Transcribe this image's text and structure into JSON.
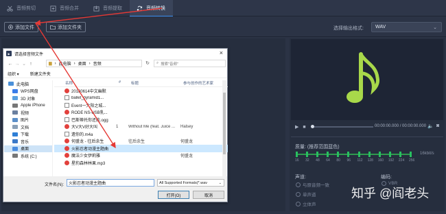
{
  "tabs": [
    {
      "label": "音频剪切",
      "icon": "scissors-icon"
    },
    {
      "label": "音频合并",
      "icon": "merge-icon"
    },
    {
      "label": "音频提取",
      "icon": "extract-icon"
    },
    {
      "label": "音频转换",
      "icon": "convert-icon",
      "active": true
    }
  ],
  "toolbar": {
    "add_file": "添加文件",
    "add_folder": "添加文件夹",
    "output_format_label": "选择输出格式:",
    "output_format_value": "WAV"
  },
  "dialog": {
    "title": "请选择音频文件",
    "close": "×",
    "breadcrumb": [
      "此电脑",
      "桌面",
      "音频"
    ],
    "search_placeholder": "搜索\"音频\"",
    "organize": "组织 ▾",
    "new_folder": "新建文件夹",
    "columns": [
      "名称",
      "#",
      "标题",
      "参与创作的艺术家"
    ],
    "nav_items": [
      "此电脑",
      "WPS网盘",
      "3D 对象",
      "Apple iPhone",
      "视频",
      "图片",
      "文档",
      "下载",
      "音乐",
      "桌面",
      "系统 (C:)"
    ],
    "files": [
      {
        "name": "20180614中文幽默",
        "num": "",
        "title": "",
        "artist": "",
        "icon": "red"
      },
      {
        "name": "ballet_pyramid1...",
        "num": "",
        "title": "",
        "artist": "",
        "icon": "doc"
      },
      {
        "name": "Event一大阳之城...",
        "num": "",
        "title": "",
        "artist": "",
        "icon": "doc"
      },
      {
        "name": "RODE NS-USB乳...",
        "num": "",
        "title": "",
        "artist": "",
        "icon": "red"
      },
      {
        "name": "巴斯蒂托你还能.ogg",
        "num": "",
        "title": "",
        "artist": "",
        "icon": "doc"
      },
      {
        "name": "大V大V好大叫",
        "num": "1",
        "title": "Without Me (feat. Juice ...",
        "artist": "Halsey",
        "icon": "red"
      },
      {
        "name": "遗你的.m4a",
        "num": "",
        "title": "",
        "artist": "",
        "icon": "doc"
      },
      {
        "name": "何盛龙 - 往后余生",
        "num": "",
        "title": "往后余生",
        "artist": "何盛龙",
        "icon": "red"
      },
      {
        "name": "火影忍者动漫主题曲",
        "num": "",
        "title": "",
        "artist": "",
        "icon": "red",
        "selected": true
      },
      {
        "name": "魔法少女伊莉雅",
        "num": "",
        "title": "",
        "artist": "何盛龙",
        "icon": "red"
      },
      {
        "name": "星豹森林林果.mp3",
        "num": "",
        "title": "",
        "artist": "",
        "icon": "red"
      }
    ],
    "filename_label": "文件名(N):",
    "filename_value": "火影忍者动漫主题曲",
    "filetype_value": "All Supported Formats(*.wav",
    "open_button": "打开(O)",
    "cancel_button": "取消"
  },
  "player": {
    "time": "00:00:00.000 / 00:00:00.000"
  },
  "quality": {
    "label": "质量: (推荐范围蓝色)",
    "unit": "16kbit/s",
    "values": [
      "16",
      "32",
      "48",
      "64",
      "80",
      "96",
      "112",
      "128",
      "160",
      "192",
      "224",
      "256"
    ]
  },
  "channel": {
    "label": "声道:",
    "options": [
      "与原音频一致",
      "单声道",
      "立体声"
    ]
  },
  "encoding": {
    "label": "编码:",
    "options": [
      "VBR"
    ]
  },
  "watermark": "知乎 @阎老头",
  "colors": {
    "accent": "#3b8ef0",
    "note": "#a8d84a",
    "slider": "#28c060",
    "arrow": "#e53935"
  }
}
